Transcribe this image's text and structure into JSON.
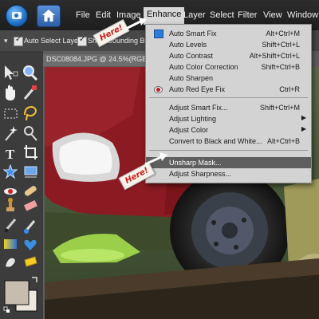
{
  "menubar": {
    "items": [
      "File",
      "Edit",
      "Image",
      "Enhance",
      "Layer",
      "Select",
      "Filter",
      "View",
      "Window"
    ],
    "active_item": "Enhance"
  },
  "options_bar": {
    "auto_select_layer": "Auto Select Layer",
    "show_bounding_box": "Show Bounding Box"
  },
  "document": {
    "tab_title": "DSC08084.JPG @ 24.5%(RGB"
  },
  "enhance_menu": {
    "auto_smart_fix": {
      "label": "Auto Smart Fix",
      "shortcut": "Alt+Ctrl+M"
    },
    "auto_levels": {
      "label": "Auto Levels",
      "shortcut": "Shift+Ctrl+L"
    },
    "auto_contrast": {
      "label": "Auto Contrast",
      "shortcut": "Alt+Shift+Ctrl+L"
    },
    "auto_color_correction": {
      "label": "Auto Color Correction",
      "shortcut": "Shift+Ctrl+B"
    },
    "auto_sharpen": {
      "label": "Auto Sharpen",
      "shortcut": ""
    },
    "auto_red_eye_fix": {
      "label": "Auto Red Eye Fix",
      "shortcut": "Ctrl+R"
    },
    "adjust_smart_fix": {
      "label": "Adjust Smart Fix...",
      "shortcut": "Shift+Ctrl+M"
    },
    "adjust_lighting": {
      "label": "Adjust Lighting",
      "shortcut": ""
    },
    "adjust_color": {
      "label": "Adjust Color",
      "shortcut": ""
    },
    "convert_bw": {
      "label": "Convert to Black and White...",
      "shortcut": "Alt+Ctrl+B"
    },
    "unsharp_mask": {
      "label": "Unsharp Mask...",
      "shortcut": ""
    },
    "adjust_sharpness": {
      "label": "Adjust Sharpness...",
      "shortcut": ""
    }
  },
  "annotations": {
    "note_1": "Here!",
    "note_2": "Here!"
  },
  "colors": {
    "menubar_bg": "#242424",
    "menu_bg": "#d3d3d3",
    "highlight": "#5f5f5f",
    "note_text": "#cc1a1a"
  }
}
